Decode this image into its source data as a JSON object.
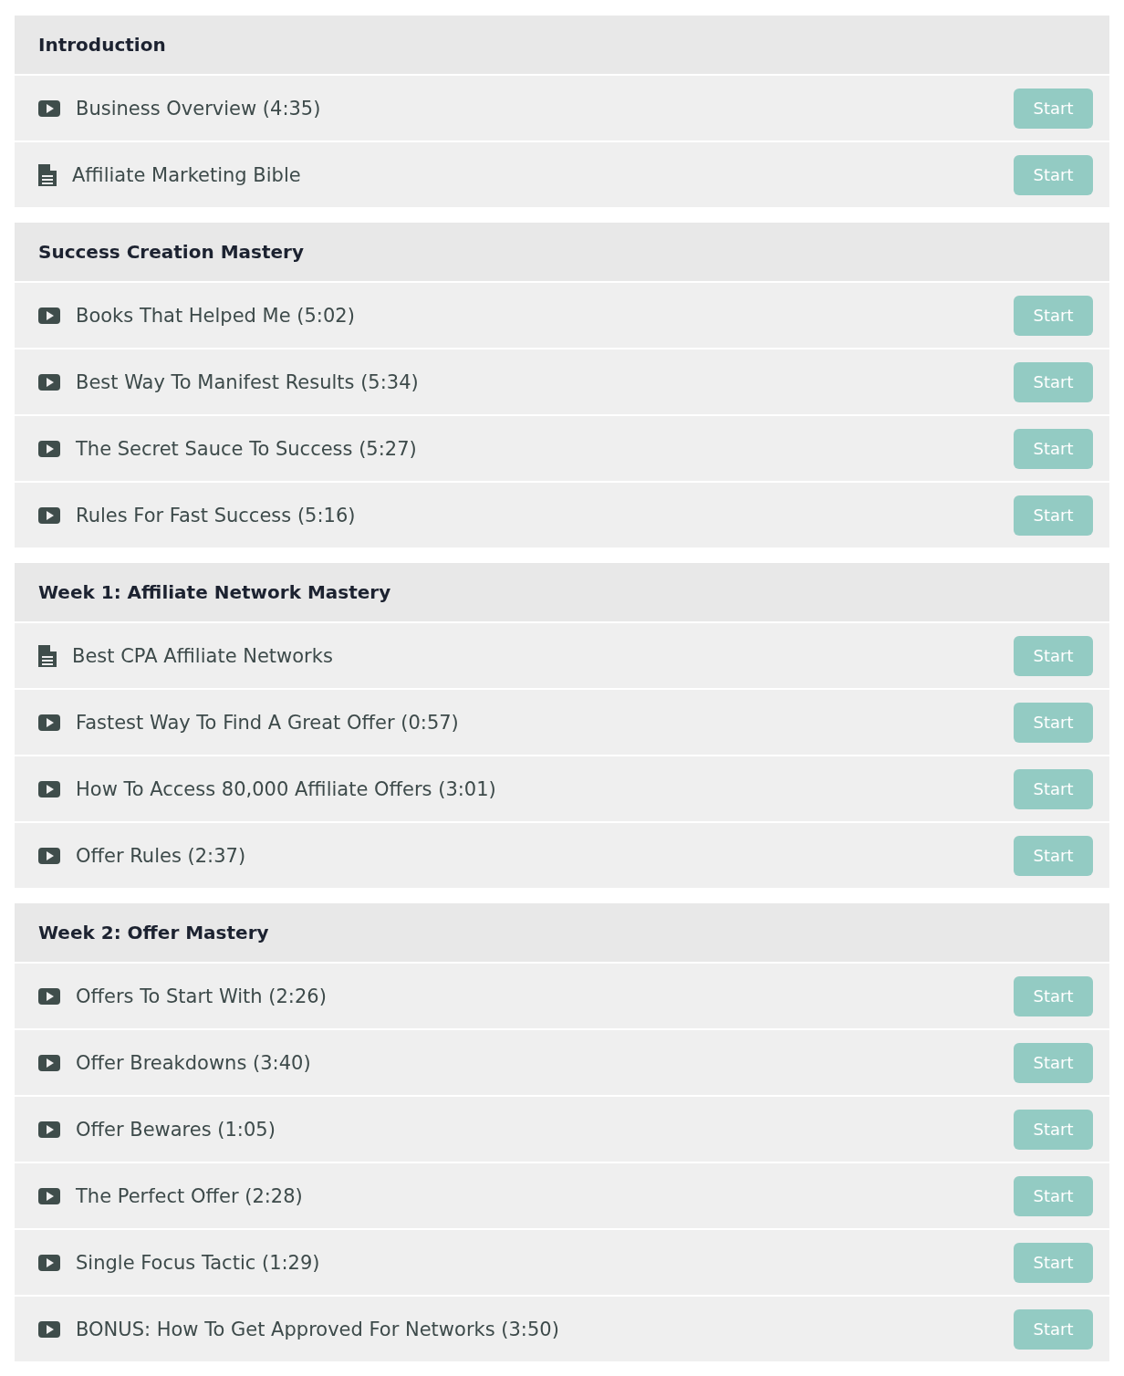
{
  "sections": [
    {
      "title": "Introduction",
      "lessons": [
        {
          "kind": "video",
          "title": "Business Overview (4:35)",
          "button": "Start"
        },
        {
          "kind": "document",
          "title": "Affiliate Marketing Bible",
          "button": "Start"
        }
      ]
    },
    {
      "title": "Success Creation Mastery",
      "lessons": [
        {
          "kind": "video",
          "title": "Books That Helped Me (5:02)",
          "button": "Start"
        },
        {
          "kind": "video",
          "title": "Best Way To Manifest Results (5:34)",
          "button": "Start"
        },
        {
          "kind": "video",
          "title": "The Secret Sauce To Success (5:27)",
          "button": "Start"
        },
        {
          "kind": "video",
          "title": "Rules For Fast Success (5:16)",
          "button": "Start"
        }
      ]
    },
    {
      "title": "Week 1: Affiliate Network Mastery",
      "lessons": [
        {
          "kind": "document",
          "title": "Best CPA Affiliate Networks",
          "button": "Start"
        },
        {
          "kind": "video",
          "title": "Fastest Way To Find A Great Offer (0:57)",
          "button": "Start"
        },
        {
          "kind": "video",
          "title": "How To Access 80,000 Affiliate Offers (3:01)",
          "button": "Start"
        },
        {
          "kind": "video",
          "title": "Offer Rules (2:37)",
          "button": "Start"
        }
      ]
    },
    {
      "title": "Week 2: Offer Mastery",
      "lessons": [
        {
          "kind": "video",
          "title": "Offers To Start With (2:26)",
          "button": "Start"
        },
        {
          "kind": "video",
          "title": "Offer Breakdowns (3:40)",
          "button": "Start"
        },
        {
          "kind": "video",
          "title": "Offer Bewares (1:05)",
          "button": "Start"
        },
        {
          "kind": "video",
          "title": "The Perfect Offer (2:28)",
          "button": "Start"
        },
        {
          "kind": "video",
          "title": "Single Focus Tactic (1:29)",
          "button": "Start"
        },
        {
          "kind": "video",
          "title": "BONUS: How To Get Approved For Networks (3:50)",
          "button": "Start"
        }
      ]
    }
  ]
}
